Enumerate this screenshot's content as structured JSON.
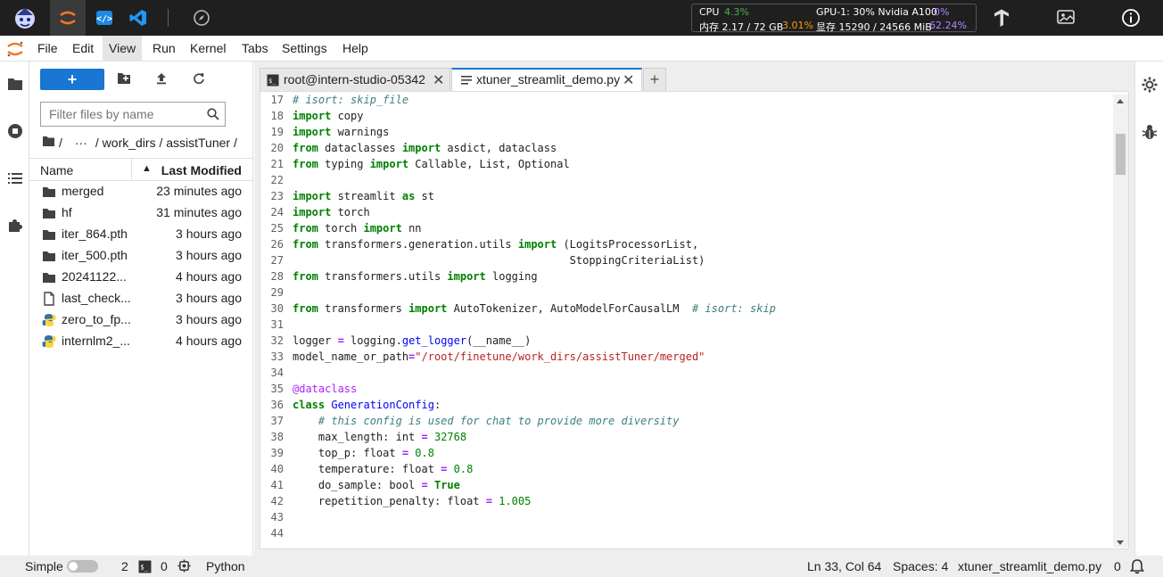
{
  "topbar": {
    "cpu_label": "CPU",
    "cpu_value": "4.3%",
    "mem_label": "内存 2.17 / 72 GB",
    "mem_value": "3.01%",
    "gpu_label": "GPU-1: 30% Nvidia A100",
    "gpu_value": "0%",
    "vram_label": "显存 15290 / 24566 MiB",
    "vram_value": "62.24%"
  },
  "menubar": {
    "items": [
      "File",
      "Edit",
      "View",
      "Run",
      "Kernel",
      "Tabs",
      "Settings",
      "Help"
    ],
    "active": "View"
  },
  "filebrowser": {
    "new_button": "+",
    "filter_placeholder": "Filter files by name",
    "breadcrumb": {
      "root": "/",
      "ellipsis": "···",
      "path": "/ work_dirs / assistTuner /"
    },
    "columns": {
      "name": "Name",
      "modified": "Last Modified"
    },
    "files": [
      {
        "name": "merged",
        "modified": "23 minutes ago",
        "type": "folder"
      },
      {
        "name": "hf",
        "modified": "31 minutes ago",
        "type": "folder"
      },
      {
        "name": "iter_864.pth",
        "modified": "3 hours ago",
        "type": "folder"
      },
      {
        "name": "iter_500.pth",
        "modified": "3 hours ago",
        "type": "folder"
      },
      {
        "name": "20241122...",
        "modified": "4 hours ago",
        "type": "folder"
      },
      {
        "name": "last_check...",
        "modified": "3 hours ago",
        "type": "file"
      },
      {
        "name": "zero_to_fp...",
        "modified": "3 hours ago",
        "type": "python"
      },
      {
        "name": "internlm2_...",
        "modified": "4 hours ago",
        "type": "python"
      }
    ]
  },
  "tabs": [
    {
      "label": "root@intern-studio-05342",
      "close": "✕",
      "icon": "terminal-icon"
    },
    {
      "label": "xtuner_streamlit_demo.py",
      "close": "✕",
      "icon": "text-file-icon",
      "active": true
    }
  ],
  "add_tab": "+",
  "code": {
    "lines": [
      {
        "n": "17",
        "t": "# isort: skip_file"
      },
      {
        "n": "18",
        "t": "import copy"
      },
      {
        "n": "19",
        "t": "import warnings"
      },
      {
        "n": "20",
        "t": "from dataclasses import asdict, dataclass"
      },
      {
        "n": "21",
        "t": "from typing import Callable, List, Optional"
      },
      {
        "n": "22",
        "t": ""
      },
      {
        "n": "23",
        "t": "import streamlit as st"
      },
      {
        "n": "24",
        "t": "import torch"
      },
      {
        "n": "25",
        "t": "from torch import nn"
      },
      {
        "n": "26",
        "t": "from transformers.generation.utils import (LogitsProcessorList,"
      },
      {
        "n": "27",
        "t": "                                           StoppingCriteriaList)"
      },
      {
        "n": "28",
        "t": "from transformers.utils import logging"
      },
      {
        "n": "29",
        "t": ""
      },
      {
        "n": "30",
        "t": "from transformers import AutoTokenizer, AutoModelForCausalLM  # isort: skip"
      },
      {
        "n": "31",
        "t": ""
      },
      {
        "n": "32",
        "t": "logger = logging.get_logger(__name__)"
      },
      {
        "n": "33",
        "t": "model_name_or_path=\"/root/finetune/work_dirs/assistTuner/merged\""
      },
      {
        "n": "34",
        "t": ""
      },
      {
        "n": "35",
        "t": "@dataclass"
      },
      {
        "n": "36",
        "t": "class GenerationConfig:"
      },
      {
        "n": "37",
        "t": "    # this config is used for chat to provide more diversity"
      },
      {
        "n": "38",
        "t": "    max_length: int = 32768"
      },
      {
        "n": "39",
        "t": "    top_p: float = 0.8"
      },
      {
        "n": "40",
        "t": "    temperature: float = 0.8"
      },
      {
        "n": "41",
        "t": "    do_sample: bool = True"
      },
      {
        "n": "42",
        "t": "    repetition_penalty: float = 1.005"
      },
      {
        "n": "43",
        "t": ""
      },
      {
        "n": "44",
        "t": ""
      }
    ]
  },
  "status": {
    "mode": "Simple",
    "terminals": "2",
    "kernels": "0",
    "language": "Python",
    "cursor": "Ln 33, Col 64",
    "indent": "Spaces: 4",
    "filename": "xtuner_streamlit_demo.py",
    "notifications": "0"
  },
  "colors": {
    "accent": "#1976d2",
    "topbar": "#1f1f1f"
  }
}
